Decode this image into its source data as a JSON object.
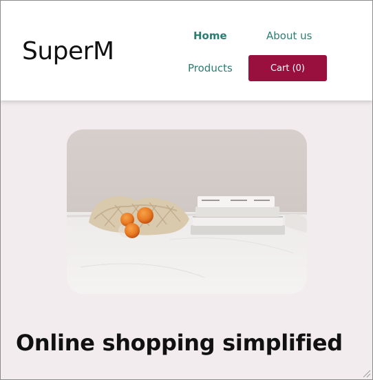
{
  "header": {
    "logo": "SuperM",
    "nav": {
      "home": "Home",
      "about": "About us",
      "products": "Products"
    },
    "cart_label": "Cart (0)"
  },
  "hero": {
    "image": "peaches-in-mesh-bag-with-books-on-marble-table",
    "title": "Online shopping simplified"
  },
  "colors": {
    "accent": "#990f3d",
    "nav_link": "#2a7d72",
    "page_bg": "#f2ecee"
  }
}
